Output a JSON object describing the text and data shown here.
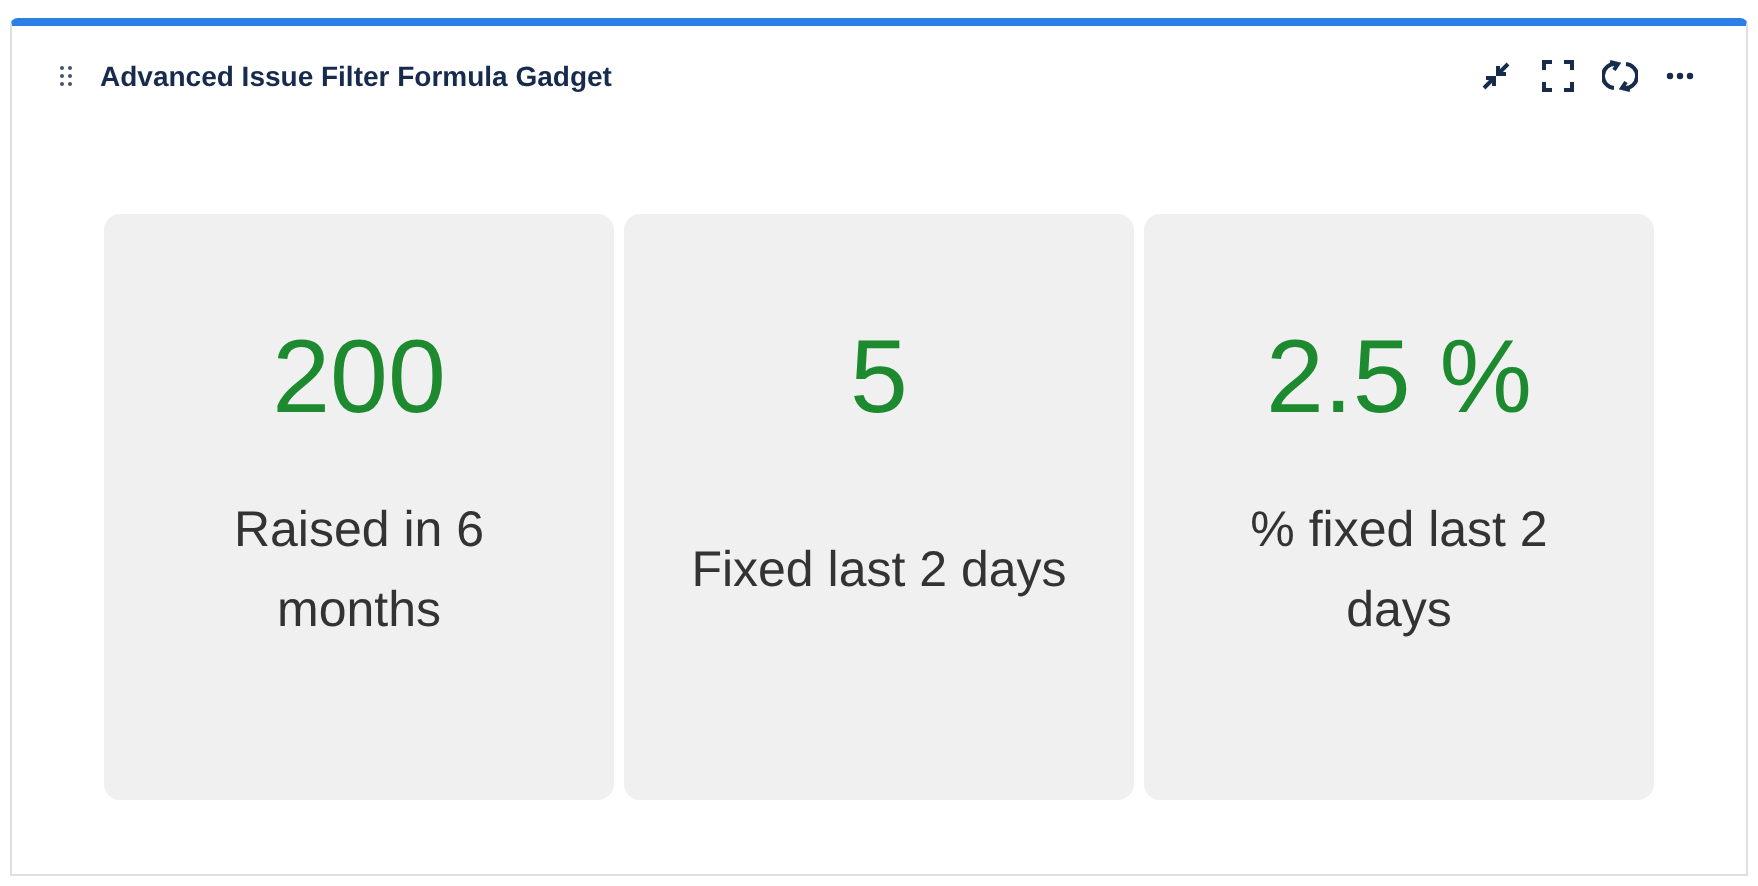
{
  "gadget": {
    "title": "Advanced Issue Filter Formula Gadget"
  },
  "metrics": [
    {
      "value": "200",
      "label": "Raised in 6 months"
    },
    {
      "value": "5",
      "label": "Fixed last 2 days"
    },
    {
      "value": "2.5 %",
      "label": "% fixed last 2 days"
    }
  ]
}
